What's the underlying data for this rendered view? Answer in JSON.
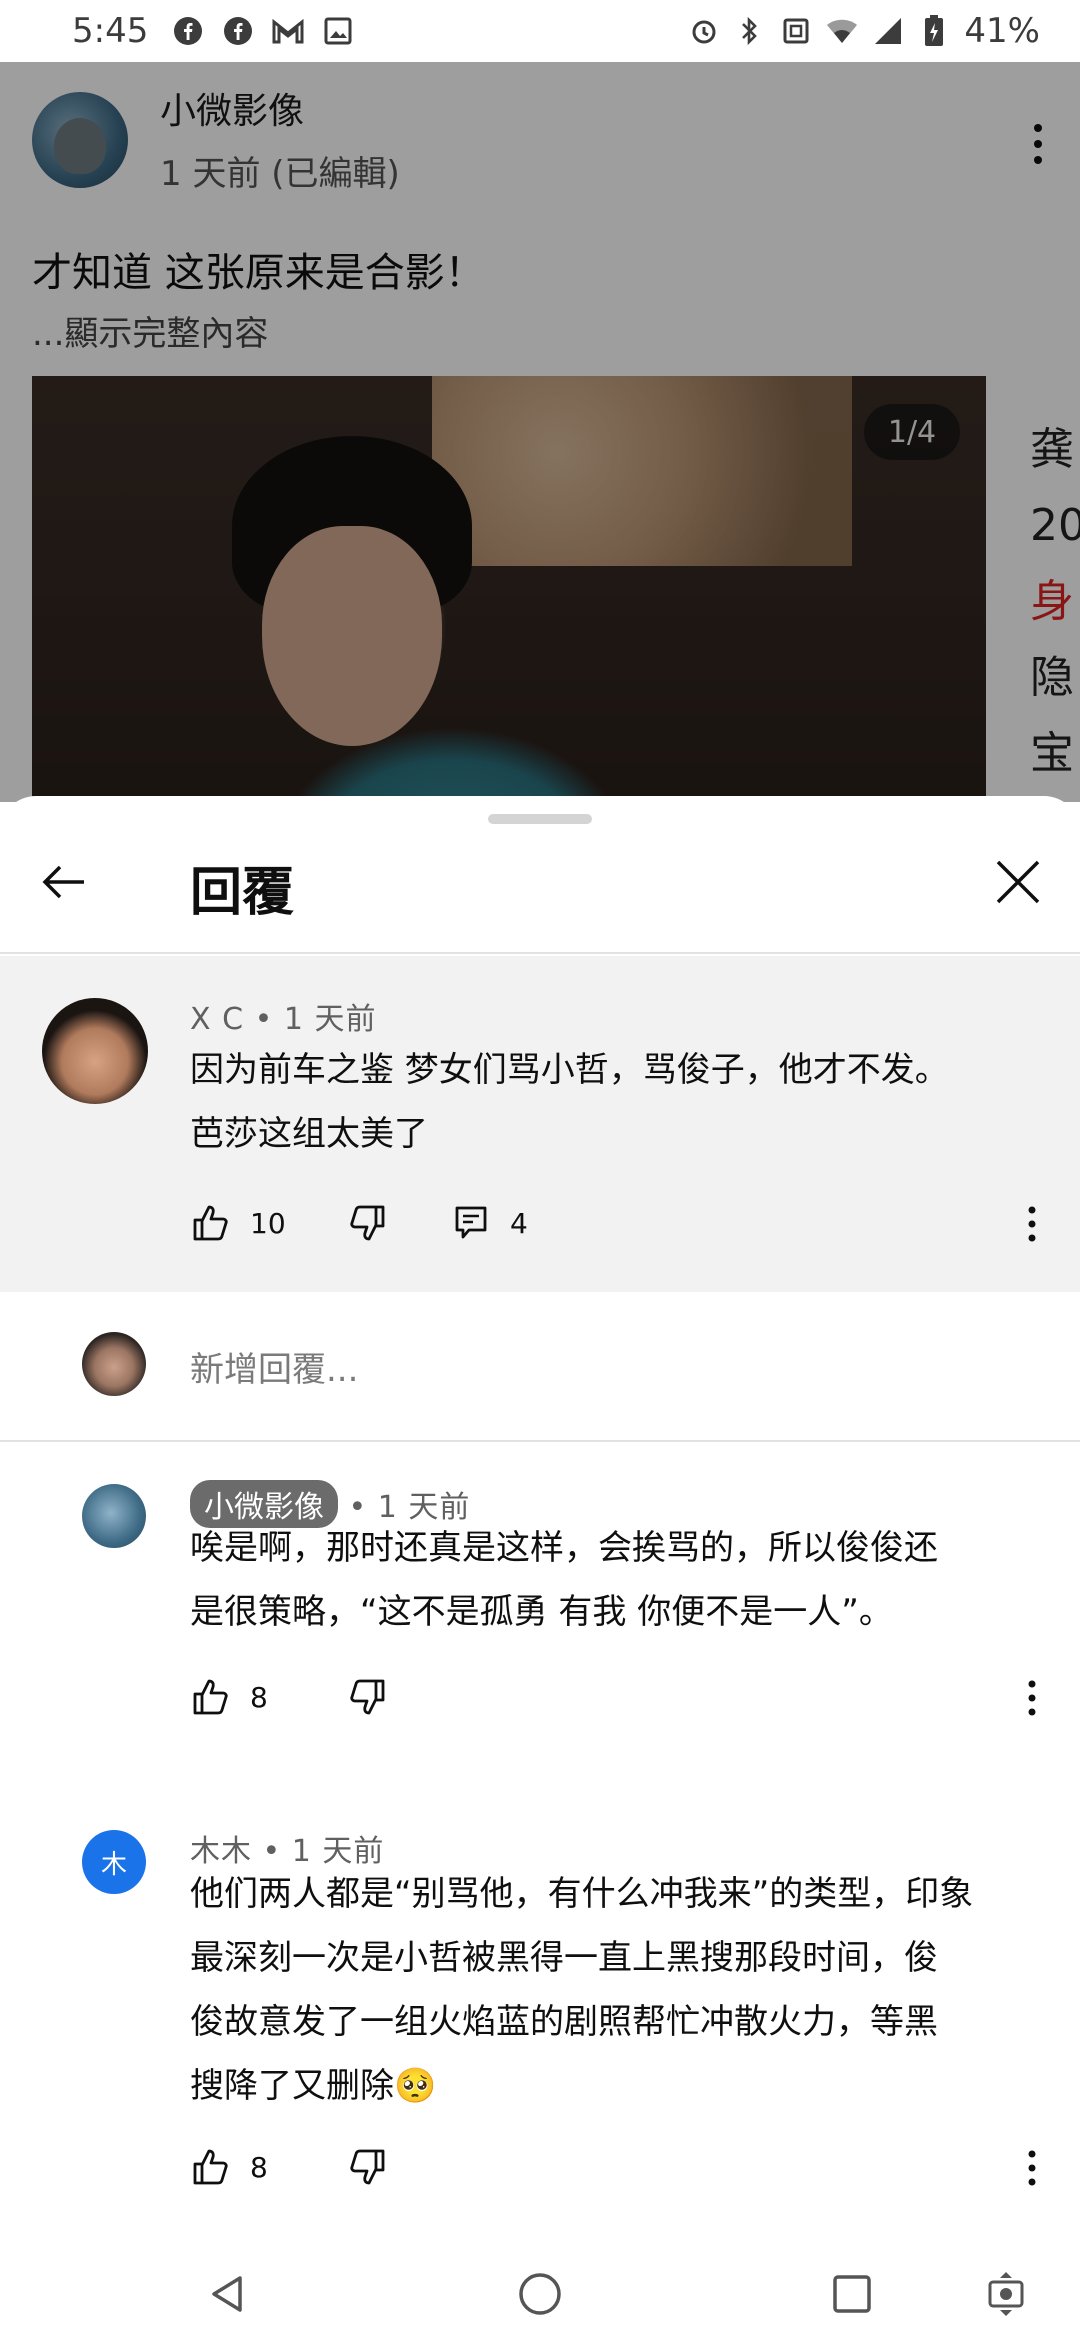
{
  "status_bar": {
    "time": "5:45",
    "battery": "41%",
    "left_icons": [
      "facebook-icon",
      "facebook-icon",
      "gmail-icon",
      "image-icon"
    ],
    "right_icons": [
      "alarm-icon",
      "bluetooth-icon",
      "nfc-icon",
      "wifi-icon",
      "signal-icon",
      "battery-icon"
    ]
  },
  "post": {
    "author": "小微影像",
    "time": "1 天前 (已編輯)",
    "title": "才知道 这张原来是合影！",
    "expand": "...顯示完整內容",
    "image_counter": "1/4",
    "next_card_chars": [
      "龚",
      "20",
      "身",
      "隐",
      "宝"
    ]
  },
  "sheet": {
    "title": "回覆"
  },
  "parent_comment": {
    "author": "X C",
    "time": "1 天前",
    "text_line1": "因为前车之鉴 梦女们骂小哲，骂俊子，他才不发。",
    "text_line2": "芭莎这组太美了",
    "likes": "10",
    "replies": "4"
  },
  "add_reply": {
    "placeholder": "新增回覆..."
  },
  "replies": [
    {
      "author": "小微影像",
      "time": "1 天前",
      "text_line1": "唉是啊，那时还真是这样，会挨骂的，所以俊俊还",
      "text_line2": "是很策略，“这不是孤勇 有我 你便不是一人”。",
      "likes": "8"
    },
    {
      "author": "木木",
      "avatar_letter": "木",
      "time": "1 天前",
      "text_line1": "他们两人都是“别骂他，有什么冲我来”的类型，印象",
      "text_line2": "最深刻一次是小哲被黑得一直上黑搜那段时间，俊",
      "text_line3": "俊故意发了一组火焰蓝的剧照帮忙冲散火力，等黑",
      "text_line4": "搜降了又删除🥺",
      "likes": "8"
    }
  ],
  "nav_bar": {
    "buttons": [
      "back-icon",
      "home-icon",
      "recents-icon",
      "screenshot-icon"
    ]
  }
}
